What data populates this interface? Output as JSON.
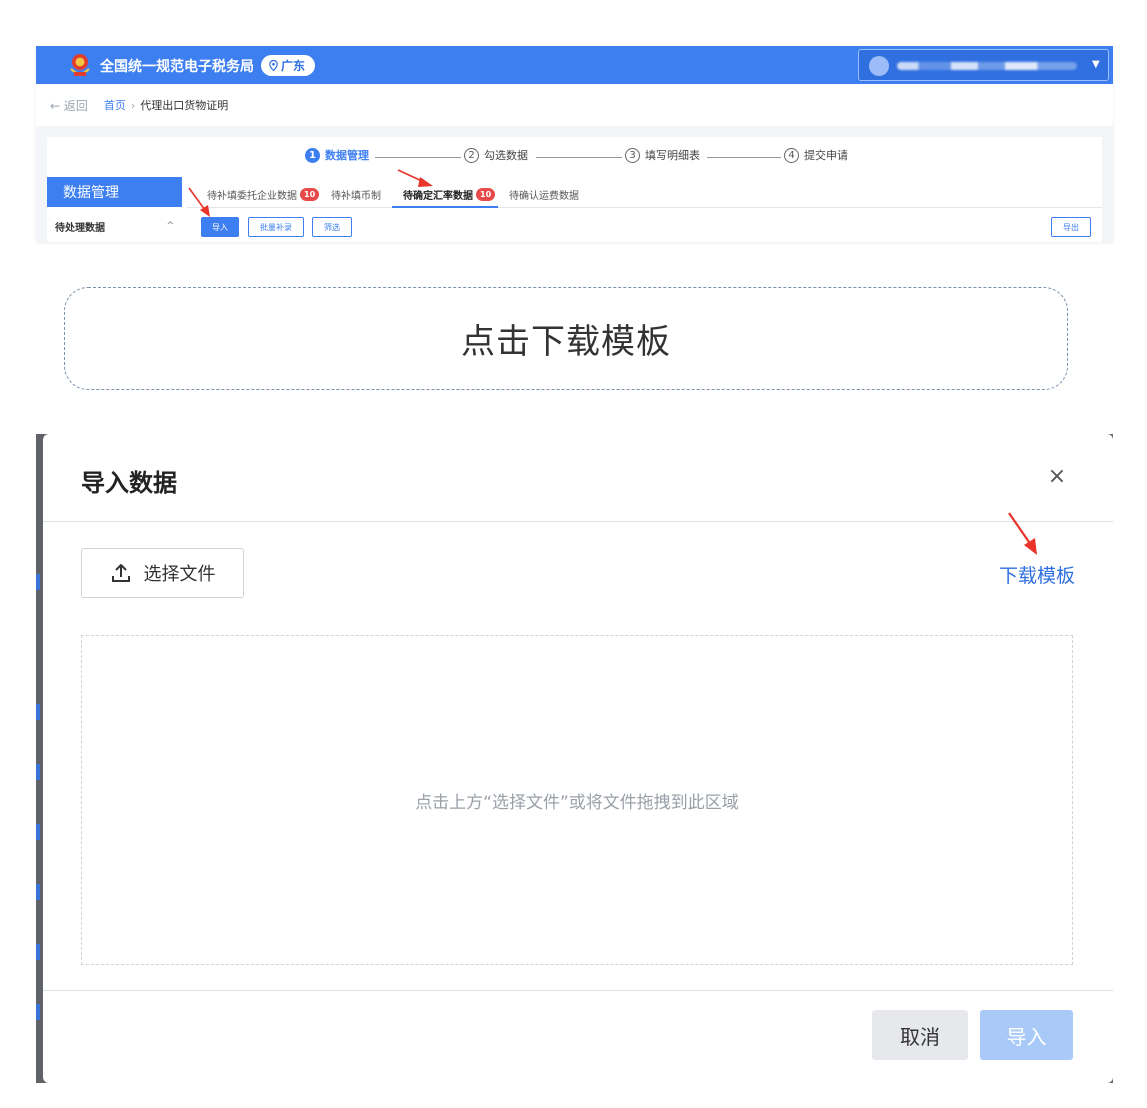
{
  "portal": {
    "site_title": "全国统一规范电子税务局",
    "region": "广东",
    "back_label": "← 返回",
    "breadcrumb_home": "首页",
    "breadcrumb_sep": "›",
    "breadcrumb_current": "代理出口货物证明",
    "steps": [
      {
        "num": "1",
        "label": "数据管理"
      },
      {
        "num": "2",
        "label": "勾选数据"
      },
      {
        "num": "3",
        "label": "填写明细表"
      },
      {
        "num": "4",
        "label": "提交申请"
      }
    ],
    "side_title": "数据管理",
    "side_sub": "待处理数据",
    "side_chevron": "^",
    "tabs": [
      {
        "label": "待补填委托企业数据",
        "badge": "10"
      },
      {
        "label": "待补填币制"
      },
      {
        "label": "待确定汇率数据",
        "badge": "10"
      },
      {
        "label": "待确认运费数据"
      }
    ],
    "buttons": {
      "import": "导入",
      "batch": "批量补录",
      "filter": "筛选",
      "export": "导出"
    }
  },
  "hint": {
    "text": "点击下载模板"
  },
  "dialog": {
    "title": "导入数据",
    "close": "×",
    "choose_file": "选择文件",
    "download_template": "下载模板",
    "drop_hint": "点击上方“选择文件”或将文件拖拽到此区域",
    "cancel": "取消",
    "import": "导入"
  },
  "colors": {
    "brand_blue": "#3d7ff0",
    "badge_red": "#e84a4a",
    "arrow_red": "#e8342a",
    "import_disabled": "#a9c9f8"
  }
}
